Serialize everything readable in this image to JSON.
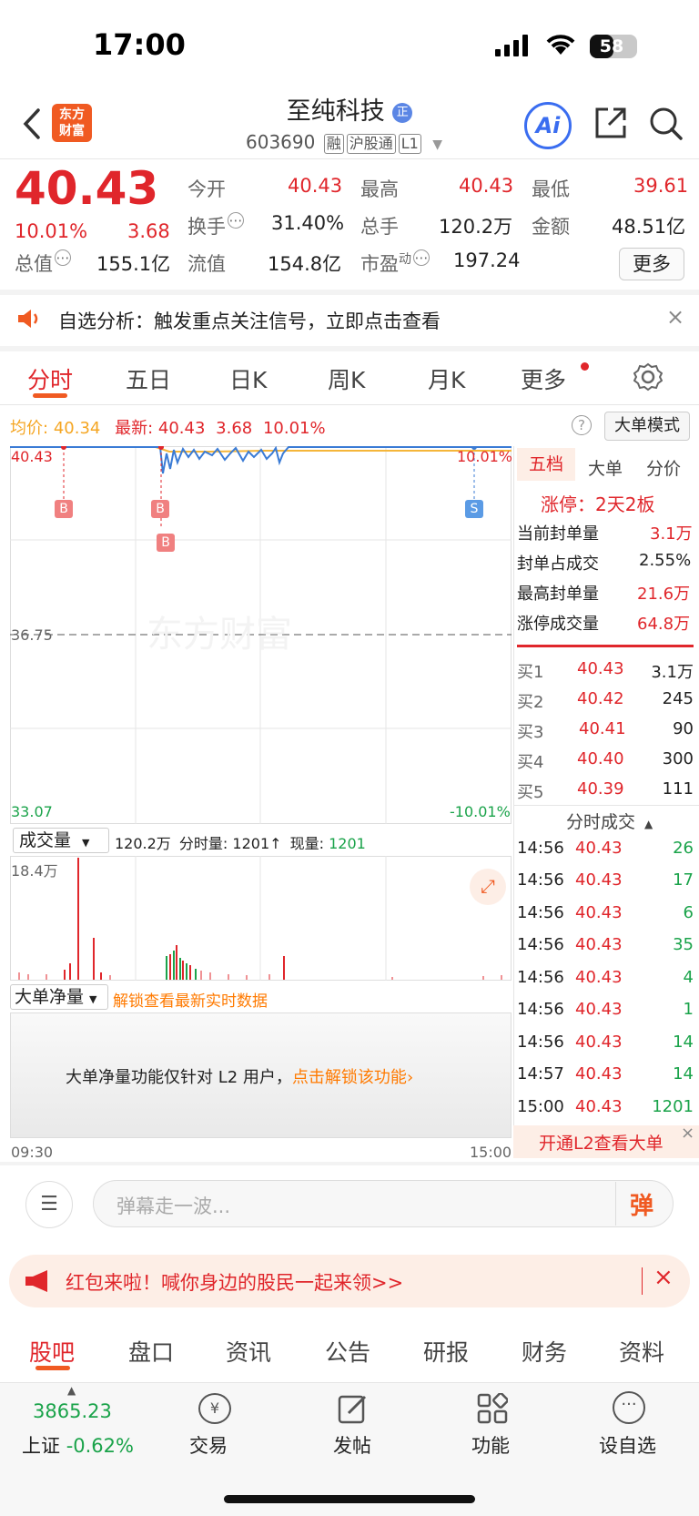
{
  "status_bar": {
    "time": "17:00",
    "battery": "58"
  },
  "header": {
    "logo_text_1": "东方",
    "logo_text_2": "财富",
    "stock_name": "至纯科技",
    "name_badge": "正",
    "stock_code": "603690",
    "tags": [
      "融",
      "沪股通",
      "L1"
    ],
    "ai_label": "Ai"
  },
  "quote": {
    "price": "40.43",
    "change_pct": "10.01%",
    "change_abs": "3.68",
    "open_label": "今开",
    "open": "40.43",
    "high_label": "最高",
    "high": "40.43",
    "low_label": "最低",
    "low": "39.61",
    "turnover_label": "换手",
    "turnover": "31.40%",
    "volume_label": "总手",
    "volume": "120.2万",
    "amount_label": "金额",
    "amount": "48.51亿",
    "mktcap_label": "总值",
    "mktcap": "155.1亿",
    "float_label": "流值",
    "float": "154.8亿",
    "pe_label": "市盈",
    "pe_sup": "动",
    "pe": "197.24",
    "more": "更多"
  },
  "alert": {
    "text": "自选分析：触发重点关注信号，立即点击查看"
  },
  "tabs": [
    "分时",
    "五日",
    "日K",
    "周K",
    "月K",
    "更多"
  ],
  "chart_header": {
    "avg_label": "均价:",
    "avg_value": "40.34",
    "latest_label": "最新:",
    "latest_value": "40.43",
    "latest_change": "3.68",
    "latest_pct": "10.01%",
    "mode_button": "大单模式"
  },
  "chart_labels": {
    "y_top": "40.43",
    "y_mid": "36.75",
    "y_bottom": "33.07",
    "pct_top": "10.01%",
    "pct_bottom": "-10.01%",
    "watermark": "东方财富",
    "x_start": "09:30",
    "x_end": "15:00",
    "markers": [
      "B",
      "B",
      "B",
      "S"
    ]
  },
  "volume_bar": {
    "selector": "成交量",
    "total": "120.2万",
    "minute_label": "分时量:",
    "minute_value": "1201",
    "current_label": "现量:",
    "current_value": "1201",
    "y_max": "18.4万"
  },
  "big_order": {
    "selector": "大单净量",
    "unlock_hint": "解锁查看最新实时数据",
    "locked_text": "大单净量功能仅针对 L2 用户，",
    "unlock_link": "点击解锁该功能"
  },
  "side_panel": {
    "tabs": [
      "五档",
      "大单",
      "分价"
    ],
    "limit_up": "涨停：2天2板",
    "stats": [
      {
        "label": "当前封单量",
        "value": "3.1万"
      },
      {
        "label": "封单占成交",
        "value": "2.55%"
      },
      {
        "label": "最高封单量",
        "value": "21.6万"
      },
      {
        "label": "涨停成交量",
        "value": "64.8万"
      }
    ],
    "bids": [
      {
        "label": "买1",
        "price": "40.43",
        "vol": "3.1万"
      },
      {
        "label": "买2",
        "price": "40.42",
        "vol": "245"
      },
      {
        "label": "买3",
        "price": "40.41",
        "vol": "90"
      },
      {
        "label": "买4",
        "price": "40.40",
        "vol": "300"
      },
      {
        "label": "买5",
        "price": "40.39",
        "vol": "111"
      }
    ],
    "ticks_title": "分时成交",
    "ticks": [
      {
        "time": "14:56",
        "price": "40.43",
        "vol": "26"
      },
      {
        "time": "14:56",
        "price": "40.43",
        "vol": "17"
      },
      {
        "time": "14:56",
        "price": "40.43",
        "vol": "6"
      },
      {
        "time": "14:56",
        "price": "40.43",
        "vol": "35"
      },
      {
        "time": "14:56",
        "price": "40.43",
        "vol": "4"
      },
      {
        "time": "14:56",
        "price": "40.43",
        "vol": "1"
      },
      {
        "time": "14:56",
        "price": "40.43",
        "vol": "14"
      },
      {
        "time": "14:57",
        "price": "40.43",
        "vol": "14"
      },
      {
        "time": "15:00",
        "price": "40.43",
        "vol": "1201"
      }
    ],
    "l2_banner": "开通L2查看大单"
  },
  "comment": {
    "placeholder": "弹幕走一波...",
    "danmu_btn": "弹"
  },
  "red_packet": {
    "text": "红包来啦！喊你身边的股民一起来领>>"
  },
  "bottom_tabs": [
    "股吧",
    "盘口",
    "资讯",
    "公告",
    "研报",
    "财务",
    "资料"
  ],
  "bottom_bar": {
    "index_value": "3865.23",
    "index_name": "上证",
    "index_change": "-0.62%",
    "items": [
      "交易",
      "发帖",
      "功能",
      "设自选"
    ]
  },
  "colors": {
    "up": "#e0262b",
    "down": "#1aa34a",
    "brand": "#f05a22",
    "avg": "#f5b63a",
    "price_line": "#3a7bd5"
  }
}
